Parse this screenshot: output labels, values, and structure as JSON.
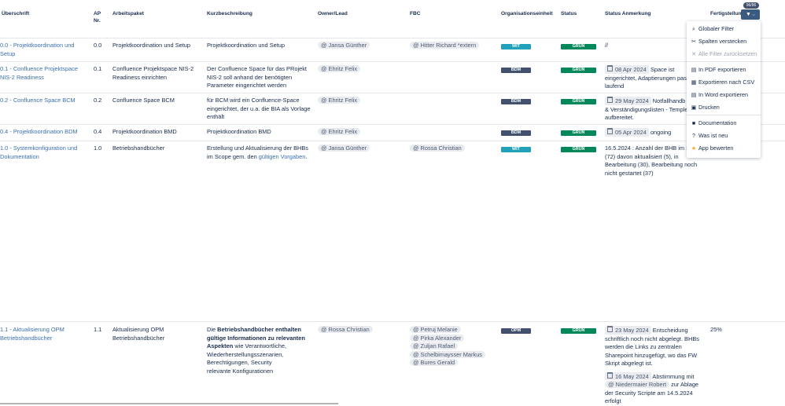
{
  "headers": {
    "ueberschrift": "Überschrift",
    "ap_nr_line1": "AP",
    "ap_nr_line2": "Nr.",
    "arbeitspaket": "Arbeitspaket",
    "kurzbeschreibung": "Kurzbeschreibung",
    "owner": "Owner/Lead",
    "fbc": "FBC",
    "orgeinheit": "Organisationseinheit",
    "status": "Status",
    "status_anmerkung": "Status Anmerkung",
    "fertigstellung": "Fertigstellun"
  },
  "filter": {
    "badge": "96/96",
    "button_icon": "filter-icon"
  },
  "menu": {
    "items": [
      {
        "label": "Globaler Filter",
        "icon": "search-icon"
      },
      {
        "label": "Spalten verstecken",
        "icon": "hide-columns-icon"
      },
      {
        "label": "Alle Filter zurücksetzen",
        "icon": "close-icon"
      },
      {
        "label": "In PDF exportieren",
        "icon": "pdf-icon"
      },
      {
        "label": "Exportieren nach CSV",
        "icon": "csv-icon"
      },
      {
        "label": "In Word exportieren",
        "icon": "word-icon"
      },
      {
        "label": "Drucken",
        "icon": "print-icon"
      },
      {
        "label": "Documentation",
        "icon": "documentation-icon"
      },
      {
        "label": "Was ist neu",
        "icon": "question-icon"
      },
      {
        "label": "App bewerten",
        "icon": "star-icon"
      }
    ]
  },
  "rows": [
    {
      "title1": "0.0 - Projektkoordination und",
      "title2": "Setup",
      "ap": "0.0",
      "ap_name1": "Projektkoordination und Setup",
      "desc1": "Projektkoordination und Setup",
      "owner": "@ Jansa Günther",
      "fbc1": "@ Hitter Richard *extern",
      "org": "WIT",
      "org_color": "#22a2ba",
      "status": "GRÜN",
      "status_color": "#00875a",
      "note1": "//"
    },
    {
      "title1": "0.1 - Confluence Projektspace",
      "title2": "NIS-2 Readiness",
      "ap": "0.1",
      "ap_name1": "Confluence Projektspace NIS-2",
      "ap_name2": "Readiness  einrichten",
      "desc1": "Der Confluence Space für das PRojekt",
      "desc2": "NIS-2 soll anhand der benötigten",
      "desc3": "Parameter eingerichtet werden",
      "owner": "@ Ehritz Felix",
      "org": "BDM",
      "org_color": "#42526e",
      "status": "GRÜN",
      "status_color": "#00875a",
      "note_date": "08 Apr 2024",
      "note1": "Space ist",
      "note2": "eingerichtet, Adaptierungen pass",
      "note3": "laufend"
    },
    {
      "title1": "0.2 - Confluence Space BCM",
      "ap": "0.2",
      "ap_name1": "Confluence Space BCM",
      "desc1": "für BCM wird ein Confluence-Space",
      "desc2": "eingerichtet, der u.a. die BIA als Vorlage",
      "desc3": "enthält",
      "owner": "@ Ehritz Felix",
      "org": "BDM",
      "org_color": "#42526e",
      "status": "GRÜN",
      "status_color": "#00875a",
      "note_date": "29 May 2024",
      "note1": "Notfallhandb",
      "note2": "& Verständigungslisten - Temple",
      "note3": "aufbereitet."
    },
    {
      "title1": "0.4 - Projektkoordination BDM",
      "ap": "0.4",
      "ap_name1": "Projektkoordination BMD",
      "desc1": "Projektkoordination BMD",
      "owner": "@ Ehritz Felix",
      "org": "BDM",
      "org_color": "#42526e",
      "status": "GRÜN",
      "status_color": "#00875a",
      "note_date": "05 Apr 2024",
      "note1": "ongoing"
    },
    {
      "title1": "1.0 - Systemkonfiguration und",
      "title2": "Dokumentation",
      "ap": "1.0",
      "ap_name1": "Betriebshandbücher",
      "desc1": "Erstellung und Aktualisierung der BHBs",
      "desc2a": "im Scope gem. den ",
      "desc2_link": "gültigen Vorgaben",
      "owner": "@ Jansa Günther",
      "fbc1": "@ Rossa Christian",
      "org": "WIT",
      "org_color": "#22a2ba",
      "status": "GRÜN",
      "status_color": "#00875a",
      "note1": "16.5.2024 :  Anzahl der BHB im S",
      "note2": "(72) davon aktualisiert (5), in",
      "note3": "Bearbeitung (30), Bearbeitung noch",
      "note4": "nicht gestartet (37)"
    },
    {
      "title1": "1.1 - Aktualisierung OPM",
      "title2": "Betriebshandbücher",
      "ap": "1.1",
      "ap_name1": "Aktualisierung OPM",
      "ap_name2": "Betriebshandbücher",
      "desc_bold1a": "Die ",
      "desc_bold1b": "Betriebshandbücher  enthalten",
      "desc_bold2": "gültige Informationen zu relevanten",
      "desc_bold3": "Aspekten",
      "desc3b": " wie Verantwortliche,",
      "desc4": "Wiederherstellungsszenarien,",
      "desc5": "Berechtigungen, Security",
      "desc6": "relevante Konfigurationen",
      "owner": "@ Rossa Christian",
      "fbc1": "@ Petruj Melanie",
      "fbc2": "@ Pirka Alexander",
      "fbc3": "@ Zuljan Rafael",
      "fbc4": "@ Schelbimaysser Markus",
      "fbc5": "@ Bures Gerald",
      "org": "OPM",
      "org_color": "#42526e",
      "status": "GRÜN",
      "status_color": "#00875a",
      "note_date": "23 May 2024",
      "note1": "Entscheidung",
      "note2": "schriftlich noch nicht abgelegt. BHBs",
      "note3": "werden die Links zu zentralen",
      "note4": "Sharepoint hinzugefügt, wo das FW",
      "note5": "Skript abgelegt ist.",
      "note_date2": "16 May 2024",
      "note6": "Abstimmung mit",
      "note_mention": "@ Niedermaier Robert",
      "note7": "zur Ablage",
      "note8": "der Security Scripte  am 14.5.2024",
      "note9": "erfolgt",
      "percent": "25%"
    }
  ]
}
